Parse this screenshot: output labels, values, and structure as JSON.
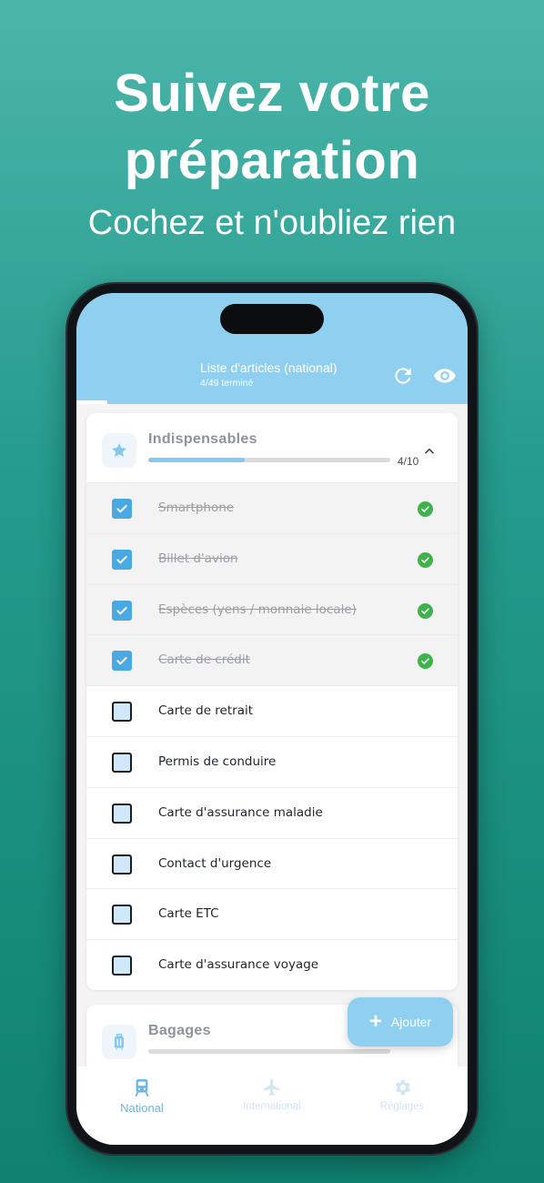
{
  "promo": {
    "title_line1": "Suivez votre",
    "title_line2": "préparation",
    "subtitle": "Cochez et n'oubliez rien"
  },
  "header": {
    "title": "Liste d'articles (national)",
    "subtitle": "4/49 terminé",
    "refresh_icon": "refresh-icon",
    "visibility_icon": "eye-icon"
  },
  "overall_progress": 0.08,
  "category_essentials": {
    "title": "Indispensables",
    "count": "4/10",
    "progress": 0.4,
    "icon": "star-icon",
    "items": [
      {
        "label": "Smartphone",
        "checked": true
      },
      {
        "label": "Billet d'avion",
        "checked": true
      },
      {
        "label": "Espèces (yens / monnaie locale)",
        "checked": true
      },
      {
        "label": "Carte de crédit",
        "checked": true
      },
      {
        "label": "Carte de retrait",
        "checked": false
      },
      {
        "label": "Permis de conduire",
        "checked": false
      },
      {
        "label": "Carte d'assurance maladie",
        "checked": false
      },
      {
        "label": "Contact d'urgence",
        "checked": false
      },
      {
        "label": "Carte ETC",
        "checked": false
      },
      {
        "label": "Carte d'assurance voyage",
        "checked": false
      }
    ]
  },
  "category_luggage": {
    "title": "Bagages",
    "icon": "suitcase-icon"
  },
  "fab": {
    "label": "Ajouter"
  },
  "nav": {
    "national": "National",
    "international": "International",
    "settings": "Réglages"
  },
  "colors": {
    "accent": "#8fd0f0",
    "check_blue": "#4aa8e3",
    "done_green": "#3fb24c"
  }
}
